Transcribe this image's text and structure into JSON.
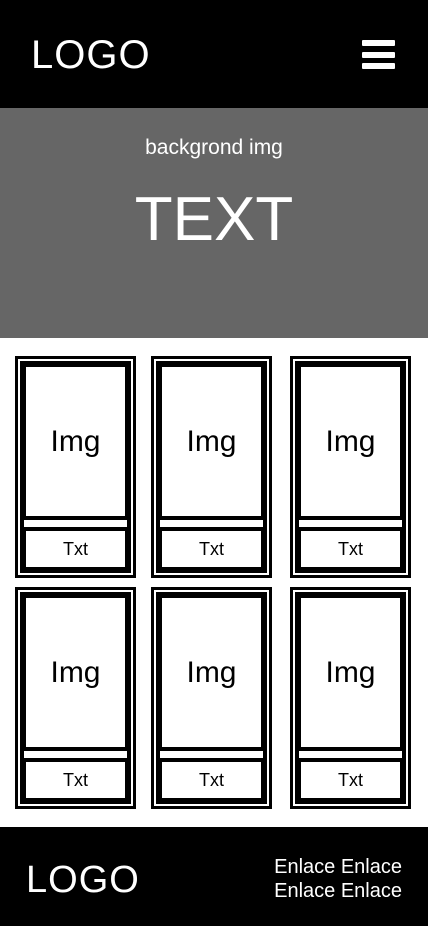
{
  "header": {
    "logo": "LOGO",
    "menu_icon": "hamburger-icon"
  },
  "hero": {
    "subtitle": "backgrond img",
    "title": "TEXT"
  },
  "cards": [
    {
      "img": "Img",
      "text": "Txt"
    },
    {
      "img": "Img",
      "text": "Txt"
    },
    {
      "img": "Img",
      "text": "Txt"
    },
    {
      "img": "Img",
      "text": "Txt"
    },
    {
      "img": "Img",
      "text": "Txt"
    },
    {
      "img": "Img",
      "text": "Txt"
    }
  ],
  "footer": {
    "logo": "LOGO",
    "links": [
      "Enlace",
      "Enlace",
      "Enlace",
      "Enlace"
    ]
  }
}
